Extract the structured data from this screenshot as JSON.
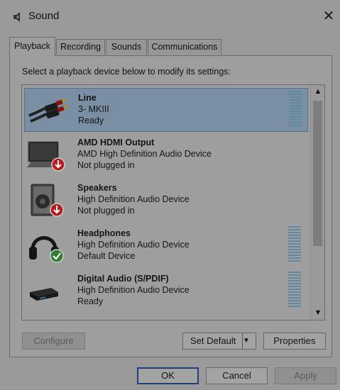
{
  "window": {
    "title": "Sound",
    "close_label": "✕"
  },
  "tabs": [
    {
      "label": "Playback"
    },
    {
      "label": "Recording"
    },
    {
      "label": "Sounds"
    },
    {
      "label": "Communications"
    }
  ],
  "panel": {
    "instruction": "Select a playback device below to modify its settings:",
    "devices": [
      {
        "name": "Line",
        "line2": "3- MKIII",
        "status": "Ready",
        "icon": "rca-cable-icon",
        "selected": true,
        "meter": true
      },
      {
        "name": "AMD HDMI Output",
        "line2": "AMD High Definition Audio Device",
        "status": "Not plugged in",
        "icon": "monitor-icon",
        "selected": false,
        "meter": false
      },
      {
        "name": "Speakers",
        "line2": "High Definition Audio Device",
        "status": "Not plugged in",
        "icon": "speaker-icon",
        "selected": false,
        "meter": false
      },
      {
        "name": "Headphones",
        "line2": "High Definition Audio Device",
        "status": "Default Device",
        "icon": "headphones-icon",
        "selected": false,
        "meter": true
      },
      {
        "name": "Digital Audio (S/PDIF)",
        "line2": "High Definition Audio Device",
        "status": "Ready",
        "icon": "spdif-device-icon",
        "selected": false,
        "meter": true
      }
    ],
    "buttons": {
      "configure": "Configure",
      "set_default": "Set Default",
      "properties": "Properties"
    }
  },
  "footer": {
    "ok": "OK",
    "cancel": "Cancel",
    "apply": "Apply"
  },
  "colors": {
    "selection": "#7a8fa3",
    "meter": "#5f8aa2",
    "default_badge": "#2e7d32",
    "unplugged_badge": "#b71c1c"
  }
}
